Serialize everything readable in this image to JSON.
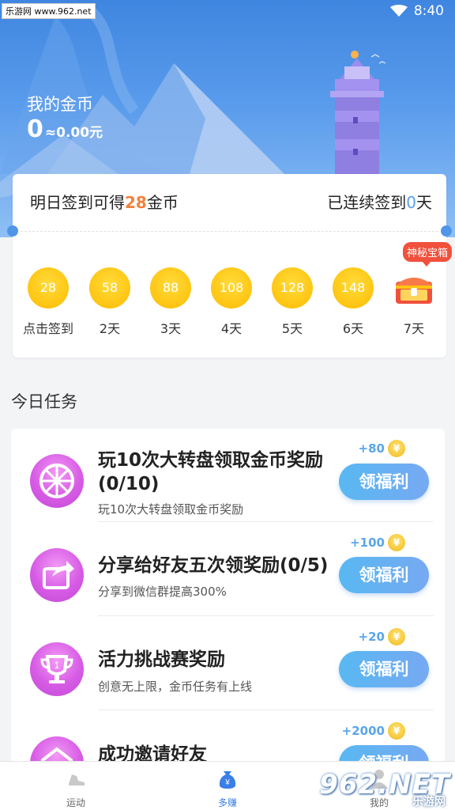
{
  "status_bar": {
    "watermark": "乐游网 www.962.net",
    "time": "8:40"
  },
  "header": {
    "coin_label": "我的金币",
    "coin_value": "0",
    "coin_cash": "≈0.00元"
  },
  "signin": {
    "tomorrow_prefix": "明日签到可得",
    "tomorrow_amount": "28",
    "tomorrow_suffix": "金币",
    "streak_prefix": "已连续签到",
    "streak_days": "0",
    "streak_suffix": "天",
    "mystery_box_label": "神秘宝箱",
    "days": [
      {
        "coins": "28",
        "label": "点击签到"
      },
      {
        "coins": "58",
        "label": "2天"
      },
      {
        "coins": "88",
        "label": "3天"
      },
      {
        "coins": "108",
        "label": "4天"
      },
      {
        "coins": "128",
        "label": "5天"
      },
      {
        "coins": "148",
        "label": "6天"
      },
      {
        "coins": "",
        "label": "7天"
      }
    ]
  },
  "tasks_section": {
    "title": "今日任务",
    "tasks": [
      {
        "title": "玩10次大转盘领取金币奖励(0/10)",
        "subtitle": "玩10次大转盘领取金币奖励",
        "reward": "+80",
        "button": "领福利",
        "icon": "wheel-icon"
      },
      {
        "title": "分享给好友五次领奖励(0/5)",
        "subtitle": "分享到微信群提高300%",
        "reward": "+100",
        "button": "领福利",
        "icon": "share-icon"
      },
      {
        "title": "活力挑战赛奖励",
        "subtitle": "创意无上限，金币任务有上线",
        "reward": "+20",
        "button": "领福利",
        "icon": "trophy-icon"
      },
      {
        "title": "成功邀请好友",
        "subtitle": "",
        "reward": "+2000",
        "button": "领福利",
        "icon": "invite-icon"
      }
    ],
    "coin_symbol": "¥"
  },
  "tabbar": {
    "items": [
      {
        "label": "运动",
        "icon": "shoe-icon"
      },
      {
        "label": "多赚",
        "icon": "money-bag-icon"
      },
      {
        "label": "我的",
        "icon": "user-icon"
      }
    ]
  },
  "brand_watermark": {
    "main": "962.NET",
    "sub": "乐游网"
  },
  "colors": {
    "primary": "#3f86e0",
    "accent_orange": "#f5813b",
    "coin_yellow": "#ffc512",
    "task_purple": "#d75be5"
  }
}
